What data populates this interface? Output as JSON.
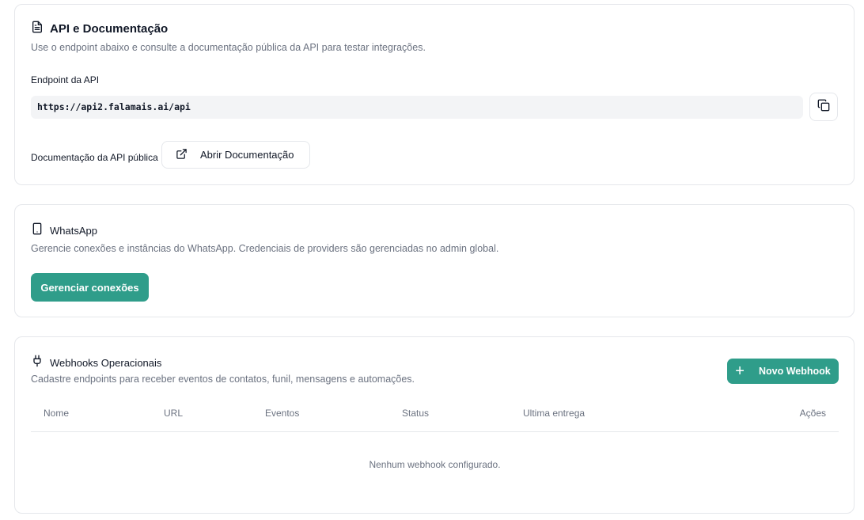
{
  "api_section": {
    "title": "API e Documentação",
    "description": "Use o endpoint abaixo e consulte a documentação pública da API para testar integrações.",
    "endpoint_label": "Endpoint da API",
    "endpoint_value": "https://api2.falamais.ai/api",
    "docs_label": "Documentação da API pública",
    "docs_button": "Abrir Documentação",
    "icons": {
      "title": "document-icon",
      "copy": "copy-icon",
      "docs": "external-link-icon"
    }
  },
  "whatsapp_section": {
    "title": "WhatsApp",
    "description": "Gerencie conexões e instâncias do WhatsApp. Credenciais de providers são gerenciadas no admin global.",
    "manage_button": "Gerenciar conexões",
    "icons": {
      "title": "smartphone-icon"
    }
  },
  "webhooks_section": {
    "title": "Webhooks Operacionais",
    "description": "Cadastre endpoints para receber eventos de contatos, funil, mensagens e automações.",
    "new_button": "Novo Webhook",
    "columns": [
      "Nome",
      "URL",
      "Eventos",
      "Status",
      "Ultima entrega",
      "Ações"
    ],
    "empty_text": "Nenhum webhook configurado.",
    "icons": {
      "title": "plug-icon",
      "new": "plus-icon"
    }
  },
  "colors": {
    "accent": "#2f9d8a",
    "border": "#e5e7eb",
    "muted_text": "#6b7280"
  }
}
